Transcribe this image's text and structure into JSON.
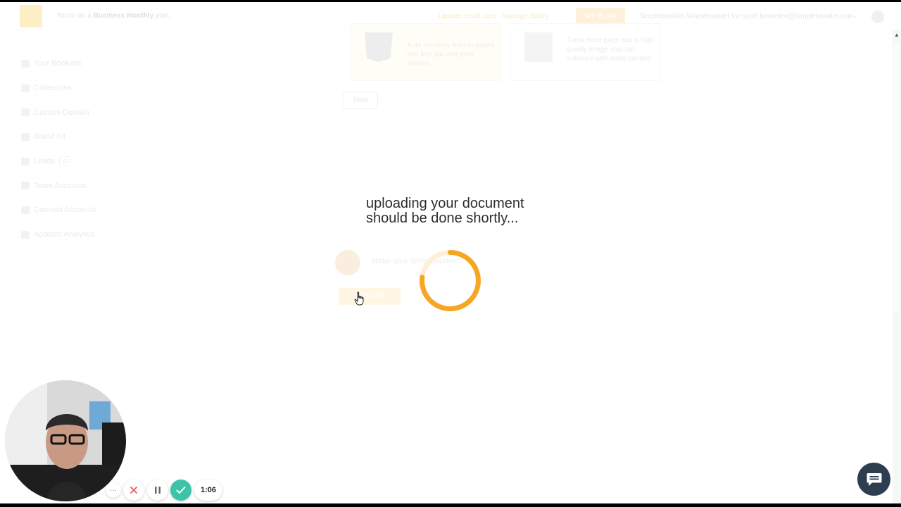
{
  "topbar": {
    "plan_prefix": "You're on a",
    "plan_name": "Business Monthly",
    "plan_suffix": "plan.",
    "trial_text": "Update credit card · Manage Billing",
    "my_plan_label": "MY PLAN",
    "account_email": "Simplebooklet Simplebooklet Inc scott.brownlee@simplebooklet.com"
  },
  "sidebar": {
    "items": [
      {
        "label": "Your Booklets",
        "icon": "booklet-icon"
      },
      {
        "label": "Collections",
        "icon": "collections-icon"
      },
      {
        "label": "Custom Domain",
        "icon": "globe-icon"
      },
      {
        "label": "Brand Kit",
        "icon": "palette-icon"
      },
      {
        "label": "Leads",
        "icon": "leads-icon",
        "badge": "0"
      },
      {
        "label": "Team Accounts",
        "icon": "team-icon"
      },
      {
        "label": "Connect Accounts",
        "icon": "link-icon"
      },
      {
        "label": "Account Analytics",
        "icon": "analytics-icon"
      }
    ]
  },
  "cards": {
    "html": {
      "text": "Auto converts links in pages and lets you edit your content."
    },
    "image": {
      "text": "Turns each page into a high quality image you can enhance with more content."
    }
  },
  "next_label": "Next",
  "assistant": {
    "prompt": "Make your Simplebooklet",
    "create_label": "CREATE",
    "secondary_label": "..."
  },
  "overlay": {
    "line1": "uploading your document",
    "line2": "should be done shortly..."
  },
  "recorder": {
    "timer": "1:06",
    "more_label": "···"
  },
  "colors": {
    "accent_orange": "#F5A623",
    "done_green": "#3CC4A9",
    "cancel_red": "#E85A5A",
    "chat_navy": "#2C3E50"
  }
}
